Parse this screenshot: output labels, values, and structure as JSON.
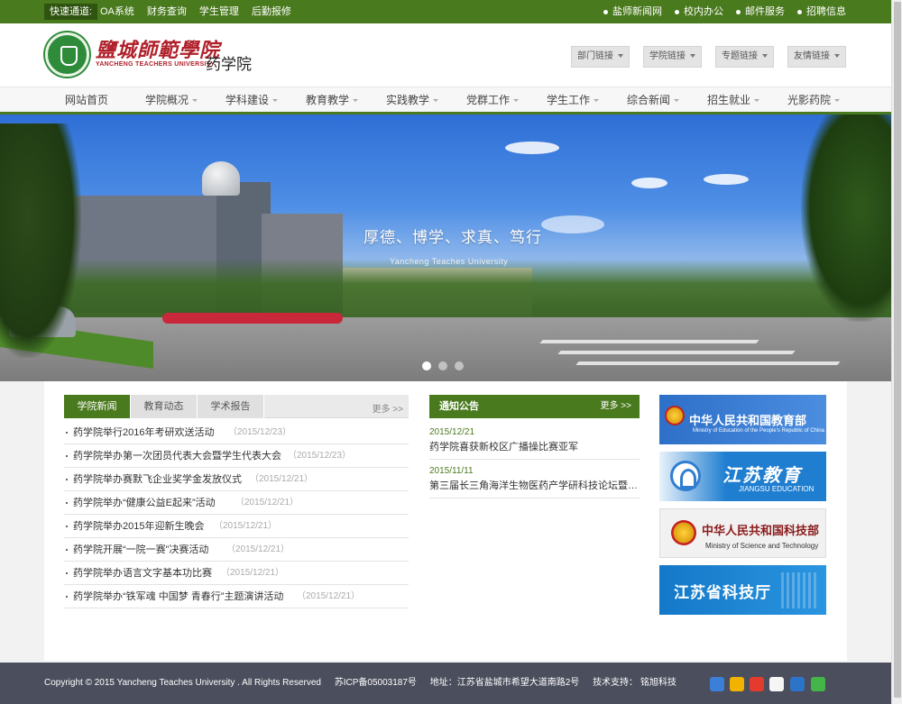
{
  "topbar": {
    "quick_label": "快速通道:",
    "links": [
      "OA系统",
      "财务查询",
      "学生管理",
      "后勤报修"
    ],
    "right_links": [
      "盐师新闻网",
      "校内办公",
      "邮件服务",
      "招聘信息"
    ]
  },
  "header": {
    "logo_cn": "鹽城師範學院",
    "logo_en": "YANCHENG TEACHERS UNIVERSITY",
    "dept": "药学院",
    "buttons": [
      "部门链接",
      "学院链接",
      "专题链接",
      "友情链接"
    ]
  },
  "nav": {
    "items": [
      "网站首页",
      "学院概况",
      "学科建设",
      "教育教学",
      "实践教学",
      "党群工作",
      "学生工作",
      "综合新闻",
      "招生就业",
      "光影药院"
    ]
  },
  "banner": {
    "motto": "厚德、博学、求真、笃行",
    "sub": "Yancheng Teaches University",
    "active_slide": 1,
    "slide_count": 3
  },
  "news": {
    "tabs": [
      "学院新闻",
      "教育动态",
      "学术报告"
    ],
    "more": "更多 >>",
    "items": [
      {
        "title": "药学院举行2016年考研欢送活动",
        "date": "（2015/12/23）"
      },
      {
        "title": "药学院举办第一次团员代表大会暨学生代表大会",
        "date": "（2015/12/23）"
      },
      {
        "title": "药学院举办赛默飞企业奖学金发放仪式",
        "date": "（2015/12/21）"
      },
      {
        "title": "药学院举办“健康公益E起来”活动",
        "date": "（2015/12/21）"
      },
      {
        "title": "药学院举办2015年迎新生晚会",
        "date": "（2015/12/21）"
      },
      {
        "title": "药学院开展“一院一赛”决赛活动",
        "date": "（2015/12/21）"
      },
      {
        "title": "药学院举办语言文字基本功比赛",
        "date": "（2015/12/21）"
      },
      {
        "title": "药学院举办“铁军魂 中国梦 青春行”主题演讲活动",
        "date": "（2015/12/21）"
      }
    ]
  },
  "notice": {
    "title": "通知公告",
    "more": "更多 >>",
    "items": [
      {
        "date": "2015/12/21",
        "title": "药学院喜获新校区广播操比赛亚军"
      },
      {
        "date": "2015/11/11",
        "title": "第三届长三角海洋生物医药产学研科技论坛暨江苏省..."
      }
    ]
  },
  "partners": [
    {
      "cn": "中华人民共和国教育部",
      "en": "Ministry of Education of the People's Republic of China"
    },
    {
      "cn": "江苏教育",
      "en": "JIANGSU EDUCATION"
    },
    {
      "cn": "中华人民共和国科技部",
      "en": "Ministry of Science and Technology"
    },
    {
      "cn": "江苏省科技厅",
      "en": ""
    }
  ],
  "footer": {
    "copyright": "Copyright © 2015  Yancheng Teaches University . All Rights Reserved",
    "icp": "苏ICP备05003187号",
    "address": "地址：江苏省盐城市希望大道南路2号",
    "support": "技术支持： 铭旭科技"
  },
  "colors": {
    "brand_green": "#4a7a1e",
    "footer_bg": "#4b4e5c"
  }
}
